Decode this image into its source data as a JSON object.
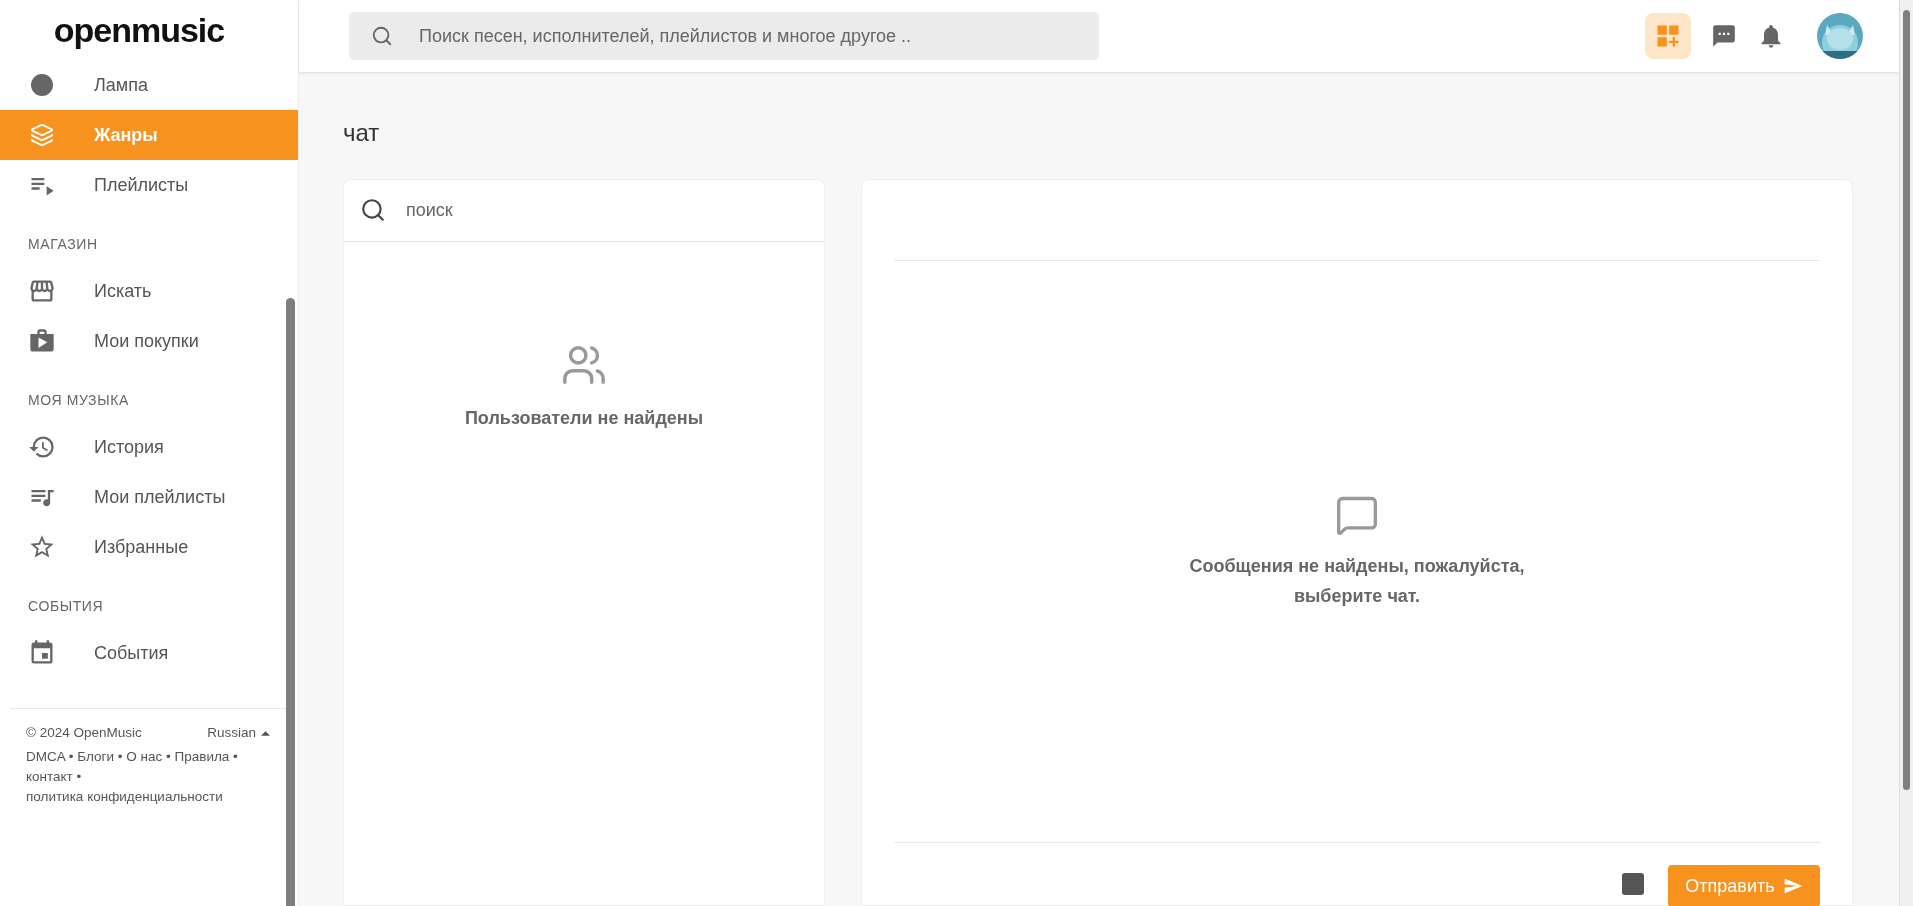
{
  "logo": {
    "text": "openmusic"
  },
  "sidebar": {
    "sections": [
      {
        "items": [
          {
            "label": "Лампа",
            "selected": false
          },
          {
            "label": "Жанры",
            "selected": true
          },
          {
            "label": "Плейлисты",
            "selected": false
          }
        ]
      },
      {
        "heading": "МАГАЗИН",
        "items": [
          {
            "label": "Искать",
            "selected": false
          },
          {
            "label": "Мои покупки",
            "selected": false
          }
        ]
      },
      {
        "heading": "МОЯ МУЗЫКА",
        "items": [
          {
            "label": "История",
            "selected": false
          },
          {
            "label": "Мои плейлисты",
            "selected": false
          },
          {
            "label": "Избранные",
            "selected": false
          }
        ]
      },
      {
        "heading": "СОБЫТИЯ",
        "items": [
          {
            "label": "События",
            "selected": false
          }
        ]
      }
    ],
    "footer": {
      "copyright": "© 2024 OpenMusic",
      "language": "Russian",
      "separator": "•",
      "links": [
        "DMCA",
        "Блоги",
        "О нас",
        "Правила",
        "контакт",
        "политика конфиденциальности"
      ]
    }
  },
  "topbar": {
    "search": {
      "placeholder": "Поиск песен, исполнителей, плейлистов и многое другое .."
    }
  },
  "page": {
    "title": "чат",
    "contacts": {
      "search": {
        "placeholder": "поиск"
      },
      "empty": "Пользователи не найдены"
    },
    "conversation": {
      "empty": "Сообщения не найдены, пожалуйста, выберите чат.",
      "send": "Отправить"
    }
  }
}
